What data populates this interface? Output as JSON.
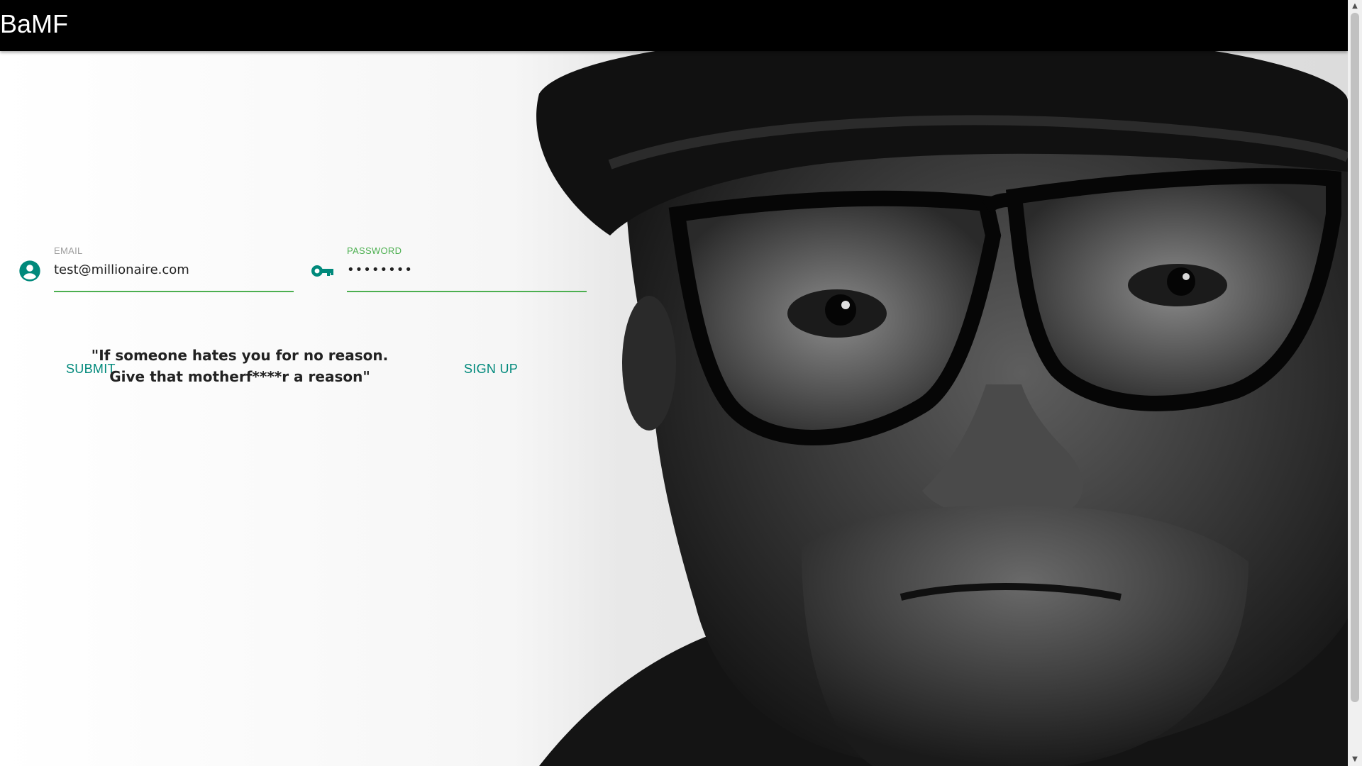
{
  "app": {
    "title": "BaMF"
  },
  "login": {
    "email_label": "EMAIL",
    "email_value": "test@millionaire.com",
    "password_label": "PASSWORD",
    "password_value": "••••••••",
    "submit_label": "SUBMIT",
    "signup_label": "SIGN UP"
  },
  "quote": {
    "line1": "\"If someone hates you for no reason.",
    "line2": "Give that motherf****r a reason\""
  },
  "icons": {
    "email": "account-circle-icon",
    "password": "key-icon",
    "scroll_up": "scroll-up-arrow",
    "scroll_down": "scroll-down-arrow"
  },
  "colors": {
    "appbar": "#000000",
    "accent": "#00897b",
    "focus_label": "#4caf50",
    "underline": "#4caf50",
    "muted_label": "#9e9e9e",
    "text": "#222222"
  }
}
